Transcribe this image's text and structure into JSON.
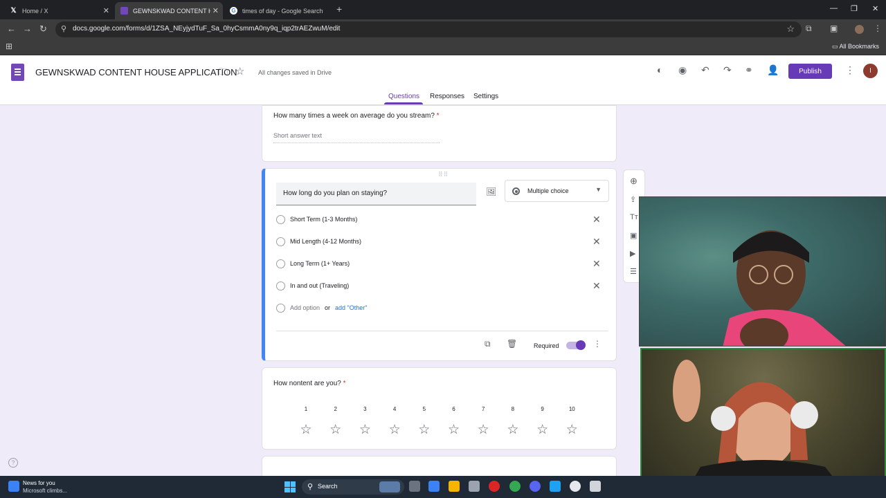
{
  "browser": {
    "tabs": [
      {
        "title": "Home / X",
        "icon": "x-logo-icon"
      },
      {
        "title": "GEWNSKWAD CONTENT HOUS",
        "icon": "google-forms-icon"
      },
      {
        "title": "times of day - Google Search",
        "icon": "google-icon"
      }
    ],
    "url": "docs.google.com/forms/d/1ZSA_NEyjydTuF_Sa_0hyCsmmA0ny9q_iqp2trAEZwuM/edit",
    "all_bookmarks": "All Bookmarks"
  },
  "form_header": {
    "title": "GEWNSKWAD CONTENT HOUSE APPLICATION",
    "save_status": "All changes saved in Drive",
    "publish_label": "Publish",
    "avatar_letter": "I",
    "tabs": {
      "questions": "Questions",
      "responses": "Responses",
      "settings": "Settings"
    },
    "accent_color": "#673ab7"
  },
  "questions": {
    "q1": {
      "title": "How many times a week on average do you stream?",
      "required_mark": "*",
      "placeholder": "Short answer text"
    },
    "q2": {
      "title": "How long do you plan on staying?",
      "type": "Multiple choice",
      "options": [
        "Short Term (1-3 Months)",
        "Mid Length (4-12 Months)",
        "Long Term (1+ Years)",
        "In and out (Traveling)"
      ],
      "add_option": "Add option",
      "or": "or",
      "add_other": "add \"Other\"",
      "required_label": "Required",
      "required": true
    },
    "q3": {
      "title": "How nontent are you?",
      "required_mark": "*",
      "scale": [
        "1",
        "2",
        "3",
        "4",
        "5",
        "6",
        "7",
        "8",
        "9",
        "10"
      ],
      "icon": "star-outline-icon"
    }
  },
  "taskbar": {
    "news_title": "News for you",
    "news_subtitle": "Microsoft climbs...",
    "search_label": "Search"
  }
}
